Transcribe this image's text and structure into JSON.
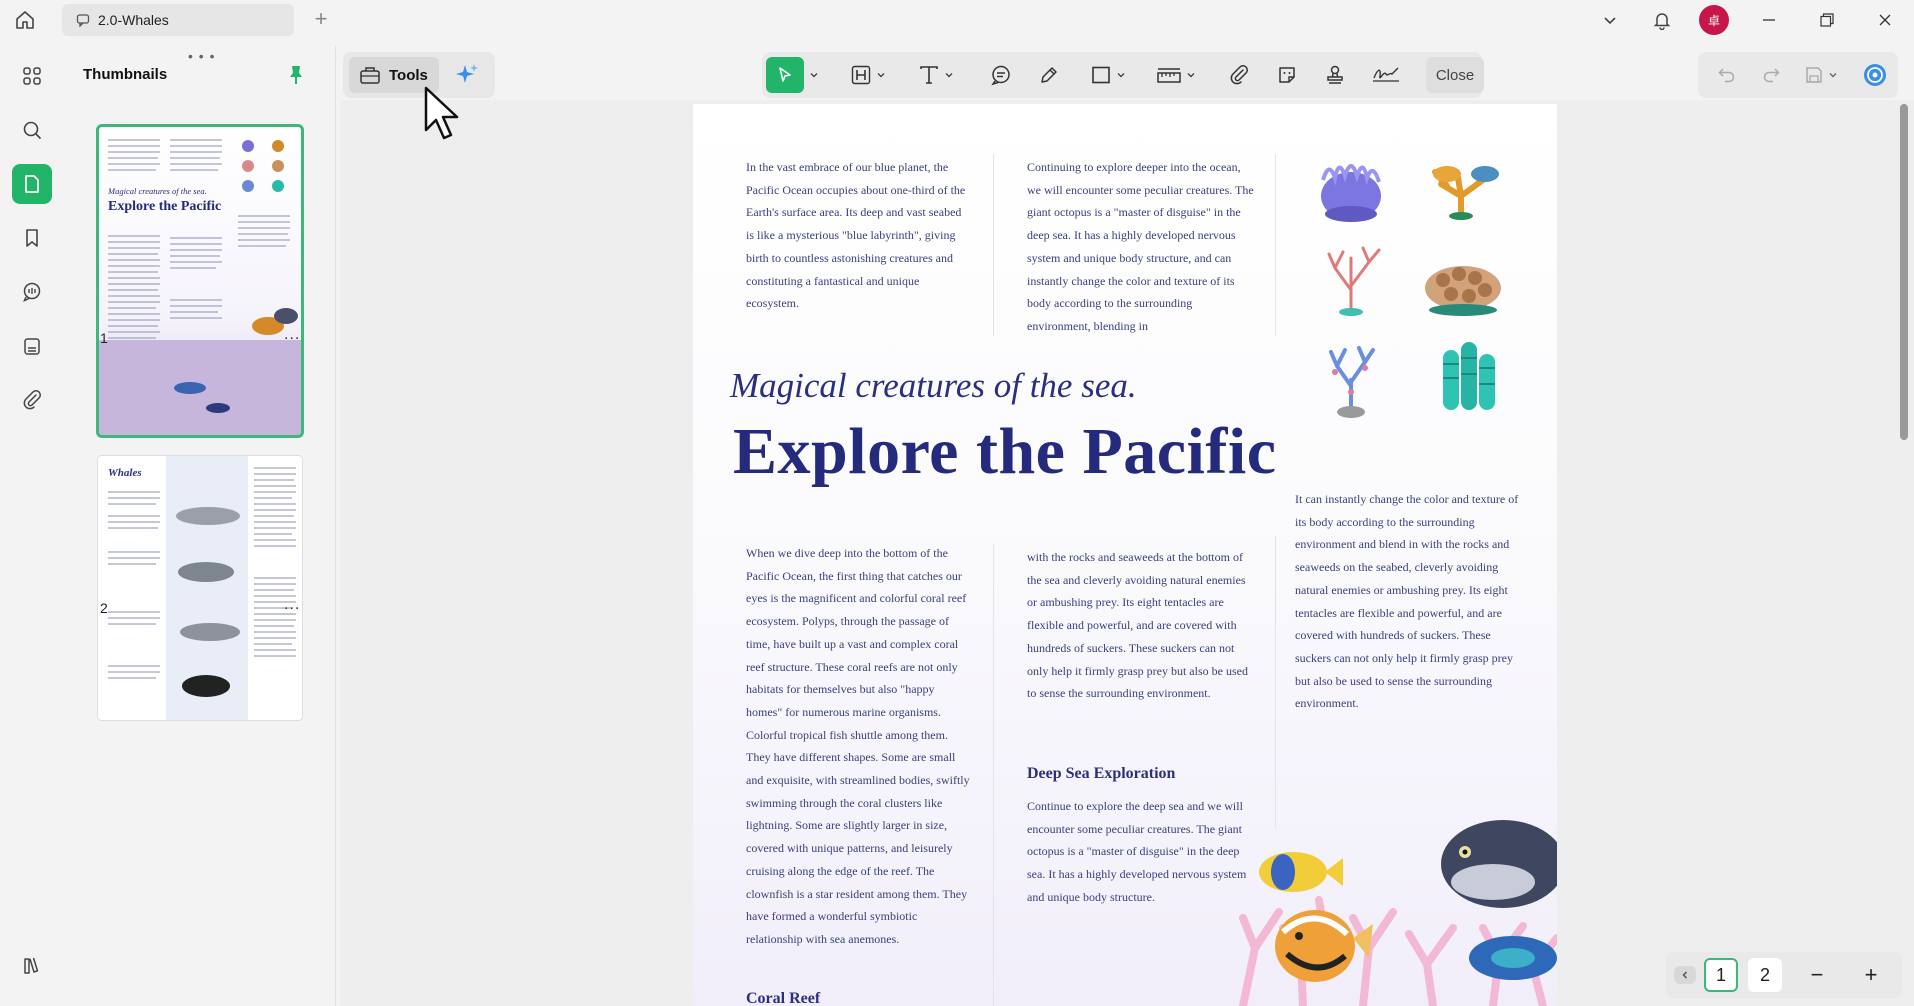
{
  "window": {
    "tab_title": "2.0-Whales",
    "avatar_initial": "卓"
  },
  "thumbnails": {
    "title": "Thumbnails",
    "pages": [
      {
        "number": "1"
      },
      {
        "number": "2"
      }
    ],
    "more": "...",
    "thumb1_sub": "Magical creatures of the sea.",
    "thumb1_title": "Explore the Pacific",
    "thumb2_title": "Whales"
  },
  "tools": {
    "label": "Tools",
    "close": "Close"
  },
  "panel_nav": {
    "prev": "‹",
    "more": "···",
    "next": "›"
  },
  "document": {
    "col1_intro": "In the vast embrace of our blue planet, the Pacific Ocean occupies about one-third of the Earth's surface area. Its deep and vast seabed is like a mysterious \"blue labyrinth\", giving birth to countless astonishing creatures and constituting a fantastical and unique ecosystem.",
    "col2_intro": "Continuing to explore deeper into the ocean, we will encounter some peculiar creatures. The giant octopus is a \"master of disguise\" in the deep sea. It has a highly developed nervous system and unique body structure, and can instantly change the color and texture of its body according to the surrounding environment, blending in",
    "subtitle": "Magical creatures of the sea.",
    "title": "Explore the Pacific",
    "col3_mid": "It can instantly change the color and texture of its body according to the surrounding environment and blend in with the rocks and seaweeds on the seabed, cleverly avoiding natural enemies or ambushing prey. Its eight tentacles are flexible and powerful, and are covered with hundreds of suckers. These suckers can not only help it firmly grasp prey but also be used to sense the surrounding environment.",
    "col1_body": "When we dive deep into the bottom of the Pacific Ocean, the first thing that catches our eyes is the magnificent and colorful coral reef ecosystem. Polyps, through the passage of time, have built up a vast and complex coral reef structure. These coral reefs are not only habitats for themselves but also \"happy homes\" for numerous marine organisms. Colorful tropical fish shuttle among them. They have different shapes. Some are small and exquisite, with streamlined bodies, swiftly swimming through the coral clusters like lightning. Some are slightly larger in size, covered with unique patterns, and leisurely cruising along the edge of the reef. The clownfish is a star resident among them. They have formed a wonderful symbiotic relationship with sea anemones.",
    "col2_body": "with the rocks and seaweeds at the bottom of the sea and cleverly avoiding natural enemies or ambushing prey. Its eight tentacles are flexible and powerful, and are covered with hundreds of suckers. These suckers can not only help it firmly grasp prey but also be used to sense the surrounding environment.",
    "section_deep": "Deep Sea Exploration",
    "deep_body": "Continue to explore the deep sea and we will encounter some peculiar creatures. The giant octopus is a \"master of disguise\" in the deep sea. It has a highly developed nervous system and unique body structure.",
    "section_coral": "Coral Reef"
  },
  "pager": {
    "pages": [
      "1",
      "2"
    ],
    "current": "1",
    "zoom_out": "−",
    "zoom_in": "+"
  },
  "colors": {
    "accent": "#22b56a",
    "title": "#242a7c",
    "text": "#3a3f7a",
    "avatar": "#c6164a"
  }
}
